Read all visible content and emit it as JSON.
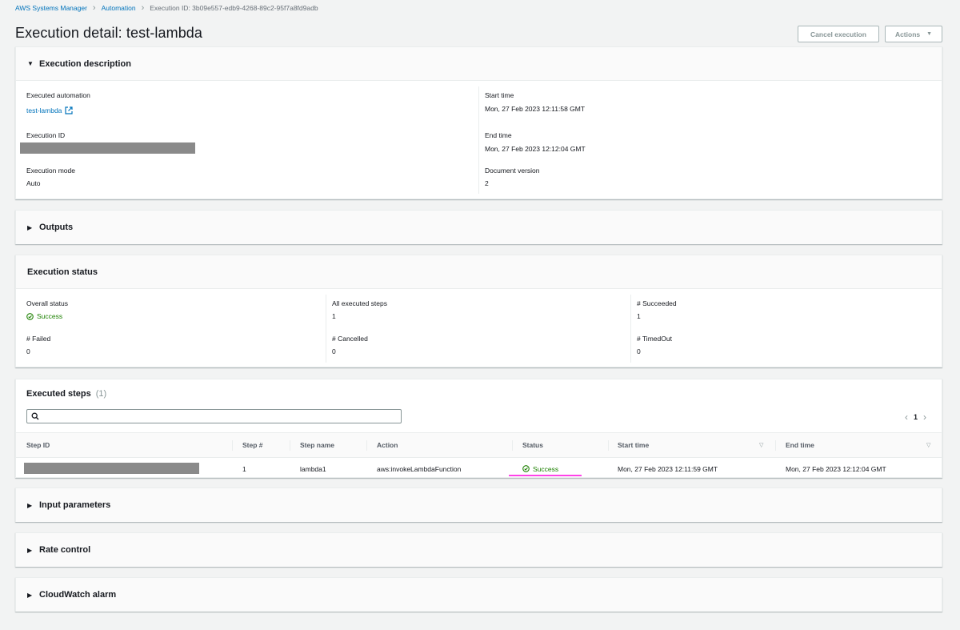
{
  "breadcrumb": {
    "items": [
      "AWS Systems Manager",
      "Automation"
    ],
    "current": "Execution ID: 3b09e557-edb9-4268-89c2-95f7a8fd9adb"
  },
  "page": {
    "title": "Execution detail: test-lambda",
    "cancel_label": "Cancel execution",
    "actions_label": "Actions"
  },
  "description": {
    "header": "Execution description",
    "executed_automation_label": "Executed automation",
    "executed_automation_value": "test-lambda",
    "execution_id_label": "Execution ID",
    "execution_mode_label": "Execution mode",
    "execution_mode_value": "Auto",
    "start_time_label": "Start time",
    "start_time_value": "Mon, 27 Feb 2023 12:11:58 GMT",
    "end_time_label": "End time",
    "end_time_value": "Mon, 27 Feb 2023 12:12:04 GMT",
    "doc_version_label": "Document version",
    "doc_version_value": "2"
  },
  "outputs": {
    "header": "Outputs"
  },
  "status": {
    "header": "Execution status",
    "overall_label": "Overall status",
    "overall_value": "Success",
    "all_steps_label": "All executed steps",
    "all_steps_value": "1",
    "succeeded_label": "# Succeeded",
    "succeeded_value": "1",
    "failed_label": "# Failed",
    "failed_value": "0",
    "cancelled_label": "# Cancelled",
    "cancelled_value": "0",
    "timedout_label": "# TimedOut",
    "timedout_value": "0"
  },
  "steps": {
    "header": "Executed steps",
    "count": "(1)",
    "search_placeholder": "",
    "page": "1",
    "columns": [
      "Step ID",
      "Step #",
      "Step name",
      "Action",
      "Status",
      "Start time",
      "End time"
    ],
    "rows": [
      {
        "step_num": "1",
        "step_name": "lambda1",
        "action": "aws:invokeLambdaFunction",
        "status": "Success",
        "start_time": "Mon, 27 Feb 2023 12:11:59 GMT",
        "end_time": "Mon, 27 Feb 2023 12:12:04 GMT"
      }
    ]
  },
  "input_parameters": {
    "header": "Input parameters"
  },
  "rate_control": {
    "header": "Rate control"
  },
  "cloudwatch": {
    "header": "CloudWatch alarm"
  },
  "colors": {
    "link": "#0073bb",
    "success": "#1d8102",
    "highlight": "#ff43e8",
    "redaction": "#8a8a8a"
  }
}
